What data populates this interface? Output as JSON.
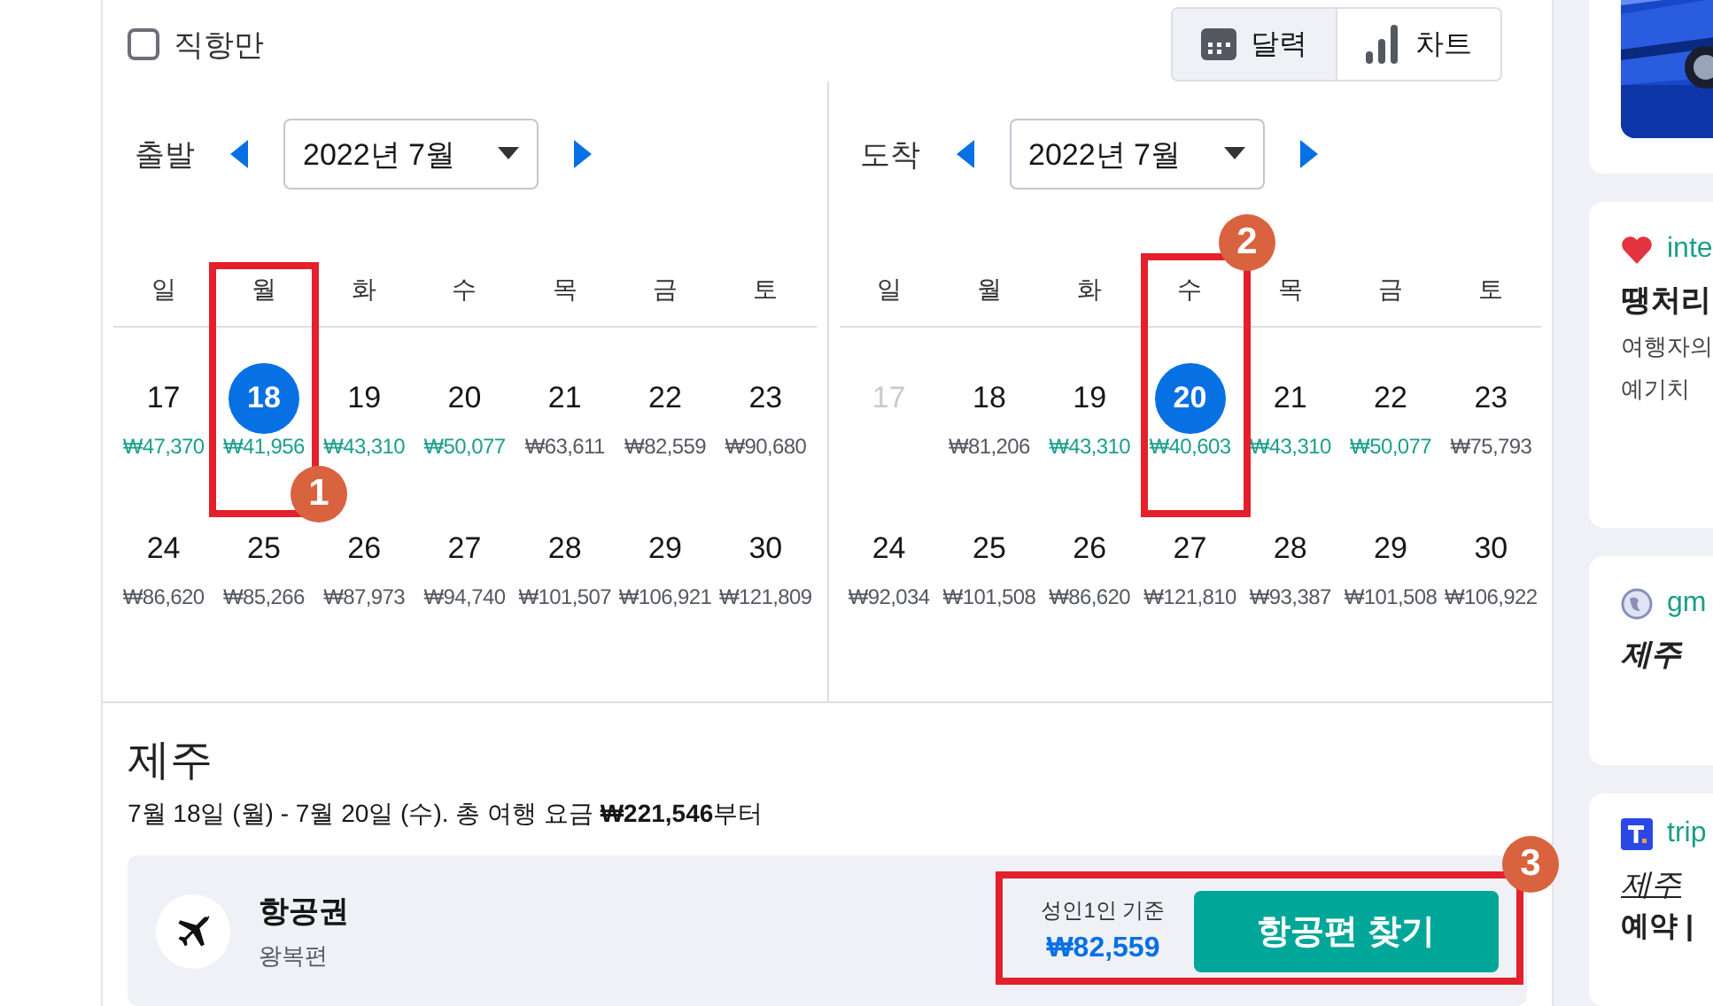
{
  "direct_only": {
    "label": "직항만",
    "checked": false
  },
  "view_toggle": [
    {
      "label": "달력",
      "selected": true
    },
    {
      "label": "차트",
      "selected": false
    }
  ],
  "calendars": [
    {
      "label": "출발",
      "month": "2022년 7월",
      "weekdays": [
        "일",
        "월",
        "화",
        "수",
        "목",
        "금",
        "토"
      ],
      "weeks": [
        [
          {
            "day": "17",
            "price": "₩47,370",
            "kind": "cheap",
            "selected": false
          },
          {
            "day": "18",
            "price": "₩41,956",
            "kind": "cheap",
            "selected": true
          },
          {
            "day": "19",
            "price": "₩43,310",
            "kind": "cheap",
            "selected": false
          },
          {
            "day": "20",
            "price": "₩50,077",
            "kind": "cheap",
            "selected": false
          },
          {
            "day": "21",
            "price": "₩63,611",
            "kind": "normal",
            "selected": false
          },
          {
            "day": "22",
            "price": "₩82,559",
            "kind": "normal",
            "selected": false
          },
          {
            "day": "23",
            "price": "₩90,680",
            "kind": "normal",
            "selected": false
          }
        ],
        [
          {
            "day": "24",
            "price": "₩86,620",
            "kind": "normal",
            "selected": false
          },
          {
            "day": "25",
            "price": "₩85,266",
            "kind": "normal",
            "selected": false
          },
          {
            "day": "26",
            "price": "₩87,973",
            "kind": "normal",
            "selected": false
          },
          {
            "day": "27",
            "price": "₩94,740",
            "kind": "normal",
            "selected": false
          },
          {
            "day": "28",
            "price": "₩101,507",
            "kind": "normal",
            "selected": false
          },
          {
            "day": "29",
            "price": "₩106,921",
            "kind": "normal",
            "selected": false
          },
          {
            "day": "30",
            "price": "₩121,809",
            "kind": "normal",
            "selected": false
          }
        ]
      ]
    },
    {
      "label": "도착",
      "month": "2022년 7월",
      "weekdays": [
        "일",
        "월",
        "화",
        "수",
        "목",
        "금",
        "토"
      ],
      "weeks": [
        [
          {
            "day": "17",
            "kind": "disabled",
            "selected": false
          },
          {
            "day": "18",
            "price": "₩81,206",
            "kind": "normal",
            "selected": false
          },
          {
            "day": "19",
            "price": "₩43,310",
            "kind": "cheap",
            "selected": false
          },
          {
            "day": "20",
            "price": "₩40,603",
            "kind": "cheap",
            "selected": true
          },
          {
            "day": "21",
            "price": "₩43,310",
            "kind": "cheap",
            "selected": false
          },
          {
            "day": "22",
            "price": "₩50,077",
            "kind": "cheap",
            "selected": false
          },
          {
            "day": "23",
            "price": "₩75,793",
            "kind": "normal",
            "selected": false
          }
        ],
        [
          {
            "day": "24",
            "price": "₩92,034",
            "kind": "normal",
            "selected": false
          },
          {
            "day": "25",
            "price": "₩101,508",
            "kind": "normal",
            "selected": false
          },
          {
            "day": "26",
            "price": "₩86,620",
            "kind": "normal",
            "selected": false
          },
          {
            "day": "27",
            "price": "₩121,810",
            "kind": "normal",
            "selected": false
          },
          {
            "day": "28",
            "price": "₩93,387",
            "kind": "normal",
            "selected": false
          },
          {
            "day": "29",
            "price": "₩101,508",
            "kind": "normal",
            "selected": false
          },
          {
            "day": "30",
            "price": "₩106,922",
            "kind": "normal",
            "selected": false
          }
        ]
      ]
    }
  ],
  "destination": {
    "title": "제주",
    "summary": "7월 18일 (월) - 7월 20일 (수). 총 여행 요금 **₩221,546**부터"
  },
  "flight": {
    "title": "항공권",
    "subtitle": "왕복편",
    "price_note": "성인1인 기준",
    "price": "₩82,559",
    "button": "항공편 찾기"
  },
  "sidebar_cards": [
    {
      "kind": "picture"
    },
    {
      "kind": "ad",
      "source": "inte",
      "title": "땡처리",
      "title_italic": false,
      "title_underline": false,
      "lines": [
        {
          "text": "여행자의",
          "bold": false
        },
        {
          "text": "예기치",
          "bold": false
        }
      ]
    },
    {
      "kind": "ad",
      "source": "gm",
      "title": "제주",
      "title_italic": true,
      "title_underline": false
    },
    {
      "kind": "ad",
      "source": "trip",
      "title": "제주",
      "title_italic": true,
      "title_underline": true,
      "lines": [
        {
          "text": "예약 |",
          "bold": true
        }
      ]
    }
  ],
  "annotations": [
    {
      "number": "1"
    },
    {
      "number": "2"
    },
    {
      "number": "3"
    }
  ]
}
